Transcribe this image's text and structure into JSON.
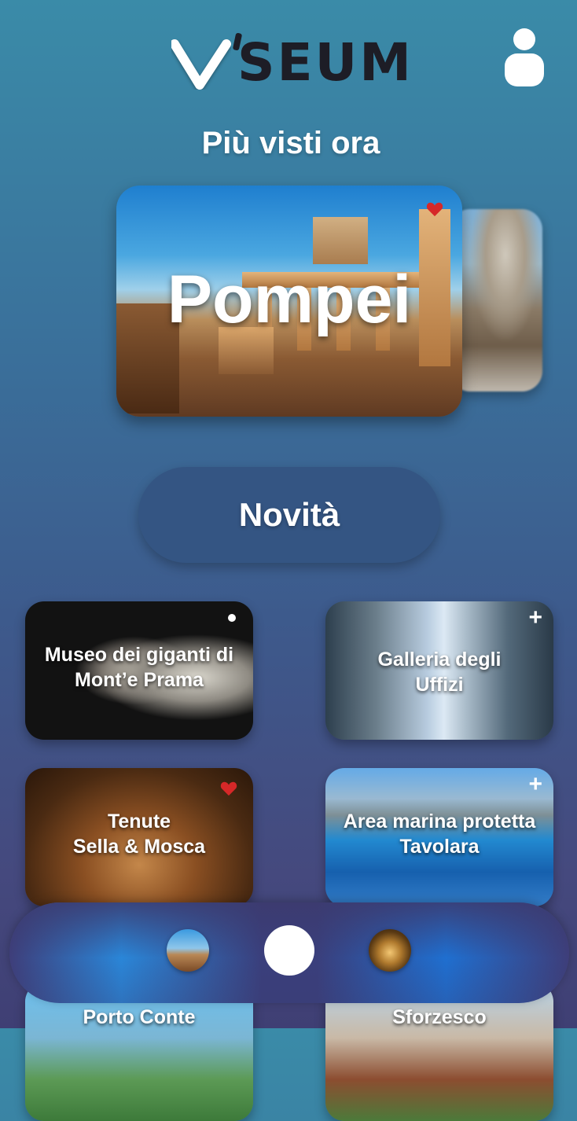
{
  "app": {
    "logo_text": "SEUM",
    "user_icon": "user-icon"
  },
  "trending": {
    "title": "Più visti ora",
    "featured": {
      "label": "Pompei",
      "favorite": true,
      "favorite_color": "#d62828"
    }
  },
  "news_button": {
    "label": "Novità"
  },
  "tiles": [
    {
      "label_line1": "Museo dei giganti di",
      "label_line2": "Mont’e Prama",
      "badge": "dot"
    },
    {
      "label_line1": "Galleria degli",
      "label_line2": "Uffizi",
      "badge": "+"
    },
    {
      "label_line1": "Tenute",
      "label_line2": "Sella & Mosca",
      "badge": "heart"
    },
    {
      "label_line1": "Area marina protetta",
      "label_line2": "Tavolara",
      "badge": "+"
    },
    {
      "label_line1": "Porto Conte",
      "label_line2": ""
    },
    {
      "label_line1": "Sforzesco",
      "label_line2": ""
    }
  ],
  "bottom_nav": {
    "items": [
      "nav-thumb-pompei",
      "home",
      "nav-thumb-cellar"
    ]
  },
  "colors": {
    "accent_heart": "#d62828",
    "pill_bg": "#345583",
    "logo_dark": "#1d1d26"
  }
}
